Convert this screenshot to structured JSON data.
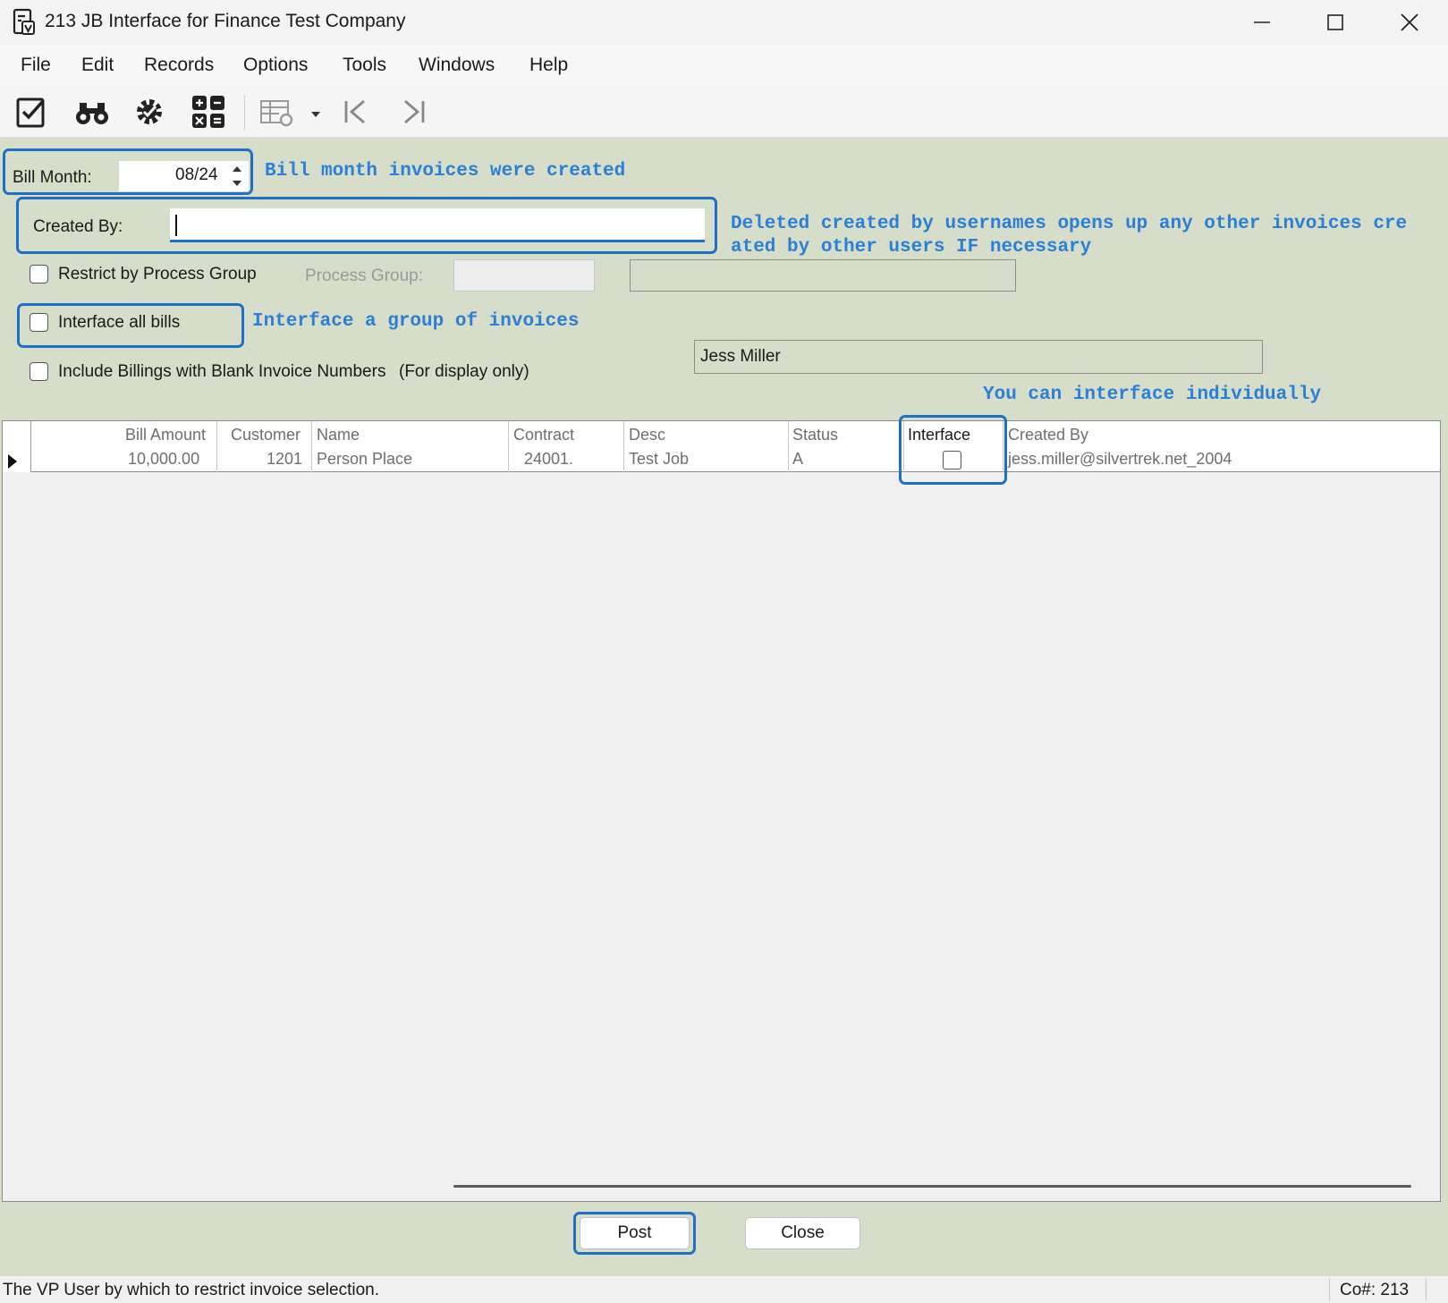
{
  "window": {
    "title": "213 JB Interface for Finance Test Company",
    "minimize_glyph": "—",
    "maximize_glyph": "☐",
    "close_glyph": "✕"
  },
  "menu": [
    "File",
    "Edit",
    "Records",
    "Options",
    "Tools",
    "Windows",
    "Help"
  ],
  "toolbar": {
    "icons": [
      "edit-check-icon",
      "binoculars-icon",
      "settings-gear-icon",
      "calculator-icon",
      "grid-settings-icon",
      "dropdown-arrow-icon",
      "first-record-icon",
      "last-record-icon"
    ]
  },
  "form": {
    "bill_month_label": "Bill Month:",
    "bill_month_value": "08/24",
    "created_by_label": "Created By:",
    "created_by_value": "",
    "restrict_label": "Restrict by Process Group",
    "process_group_label": "Process Group:",
    "interface_all_label": "Interface all bills",
    "include_blank_label": "Include Billings with Blank Invoice Numbers",
    "include_blank_note": "(For display only)",
    "user_display": "Jess Miller"
  },
  "annotations": {
    "bill_month": "Bill month invoices were created",
    "created_by_line1": "Deleted created by usernames opens up any other invoices cre",
    "created_by_line2": "ated by other users IF necessary",
    "interface_all": "Interface a group of invoices",
    "individual": "You can interface individually"
  },
  "grid": {
    "columns": [
      "Bill Amount",
      "Customer",
      "Name",
      "Contract",
      "Desc",
      "Status",
      "Interface",
      "Created By"
    ],
    "rows": [
      {
        "bill_amount": "10,000.00",
        "customer": "1201",
        "name": "Person Place",
        "contract": "24001.",
        "desc": "Test Job",
        "status": "A",
        "interface": false,
        "created_by": "jess.miller@silvertrek.net_2004"
      }
    ]
  },
  "buttons": {
    "post": "Post",
    "close": "Close"
  },
  "status": {
    "text": "The VP User by which to restrict invoice selection.",
    "company": "Co#: 213"
  },
  "colors": {
    "form_bg": "#d6ddc9",
    "highlight": "#1f6fc4",
    "annotation": "#2a7fd6"
  }
}
